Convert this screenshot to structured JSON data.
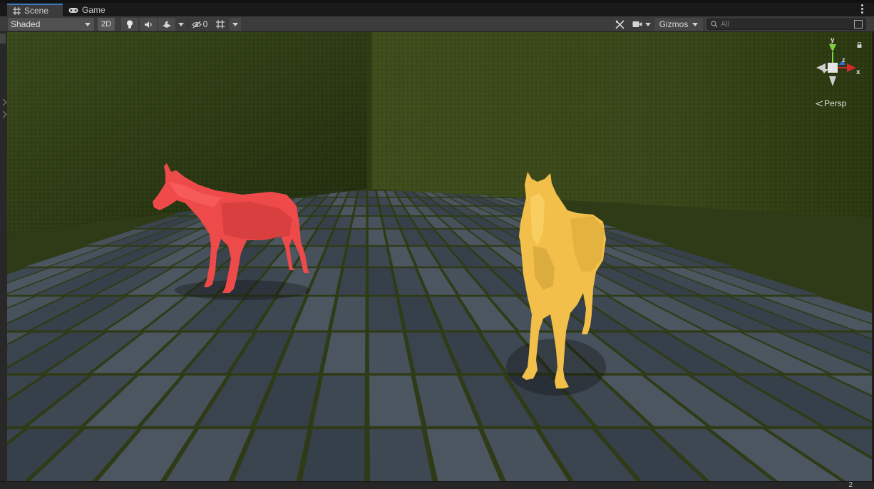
{
  "tabs": [
    {
      "label": "Scene",
      "icon": "grid-icon",
      "active": true
    },
    {
      "label": "Game",
      "icon": "gamepad-icon",
      "active": false
    }
  ],
  "toolbar": {
    "draw_mode": "Shaded",
    "mode_2d_label": "2D",
    "lighting_icon": "lightbulb-icon",
    "audio_icon": "speaker-icon",
    "effects_icon": "effects-icon",
    "hidden_count": "0",
    "grid_icon": "grid-toggle-icon",
    "tools_icon": "tools-icon",
    "camera_icon": "camera-icon",
    "gizmos_label": "Gizmos",
    "search_placeholder": "All"
  },
  "viewport": {
    "projection_label": "Persp",
    "gizmo_axes": [
      "y",
      "z",
      "x"
    ],
    "objects": [
      {
        "name": "horse-red",
        "color": "#ee4a4a"
      },
      {
        "name": "horse-yellow",
        "color": "#f2c04a"
      }
    ]
  },
  "statusbar": {
    "right_text": "2"
  },
  "colors": {
    "accent": "#3a79bb",
    "panel": "#3c3c3c",
    "axis_x": "#d42c2c",
    "axis_y": "#7ed43a",
    "axis_z": "#2f6fd8"
  }
}
